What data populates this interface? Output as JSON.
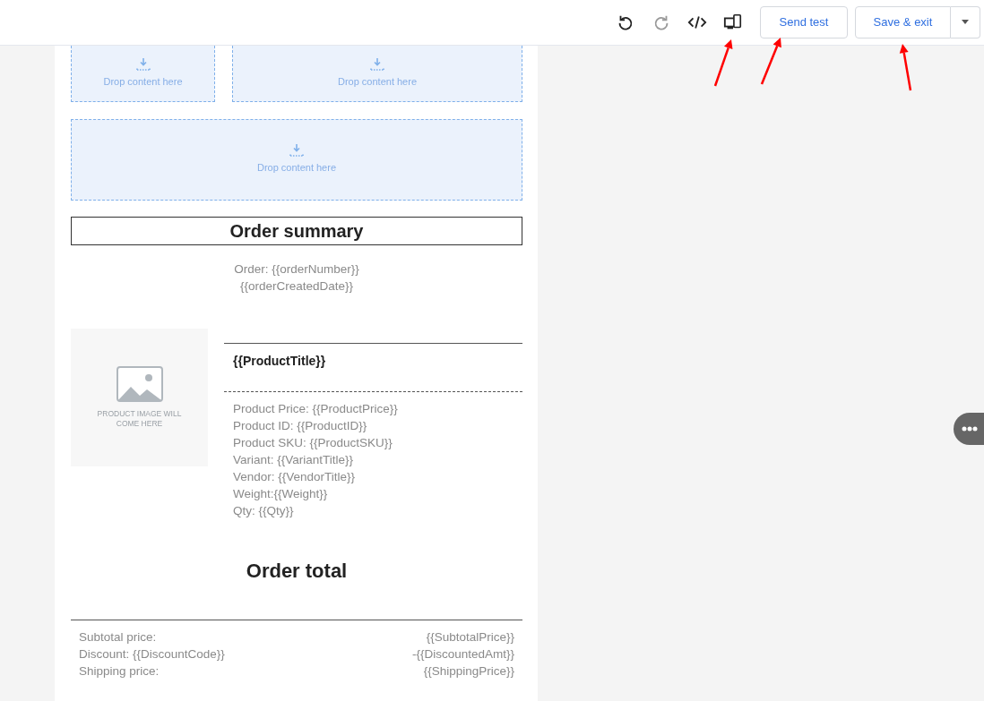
{
  "toolbar": {
    "tools": [
      {
        "kind": "undo",
        "disabled": false
      },
      {
        "kind": "redo",
        "disabled": true
      },
      {
        "kind": "code",
        "disabled": false
      },
      {
        "kind": "devices",
        "disabled": false
      }
    ],
    "send_test": "Send test",
    "save": "Save & exit"
  },
  "drop_zone_rows": [
    [
      {
        "label": "Drop content here"
      },
      {
        "label": "Drop content here"
      }
    ],
    [
      {
        "label": "Drop content here"
      }
    ]
  ],
  "order_summary": {
    "title": "Order summary",
    "lines": [
      "Order: {{orderNumber}}",
      "{{orderCreatedDate}}"
    ]
  },
  "product": {
    "image_text": "PRODUCT IMAGE WILL COME HERE",
    "title": "{{ProductTitle}}",
    "details": [
      "Product Price: {{ProductPrice}}",
      "Product ID: {{ProductID}}",
      "Product SKU: {{ProductSKU}}",
      "Variant: {{VariantTitle}}",
      "Vendor: {{VendorTitle}}",
      "Weight:{{Weight}}",
      "Qty: {{Qty}}"
    ]
  },
  "order_total": {
    "title": "Order total",
    "rows": [
      {
        "label": "Subtotal price:",
        "value": "{{SubtotalPrice}}"
      },
      {
        "label": "Discount: {{DiscountCode}}",
        "value": "-{{DiscountedAmt}}"
      },
      {
        "label": "Shipping price:",
        "value": "{{ShippingPrice}}"
      }
    ]
  }
}
